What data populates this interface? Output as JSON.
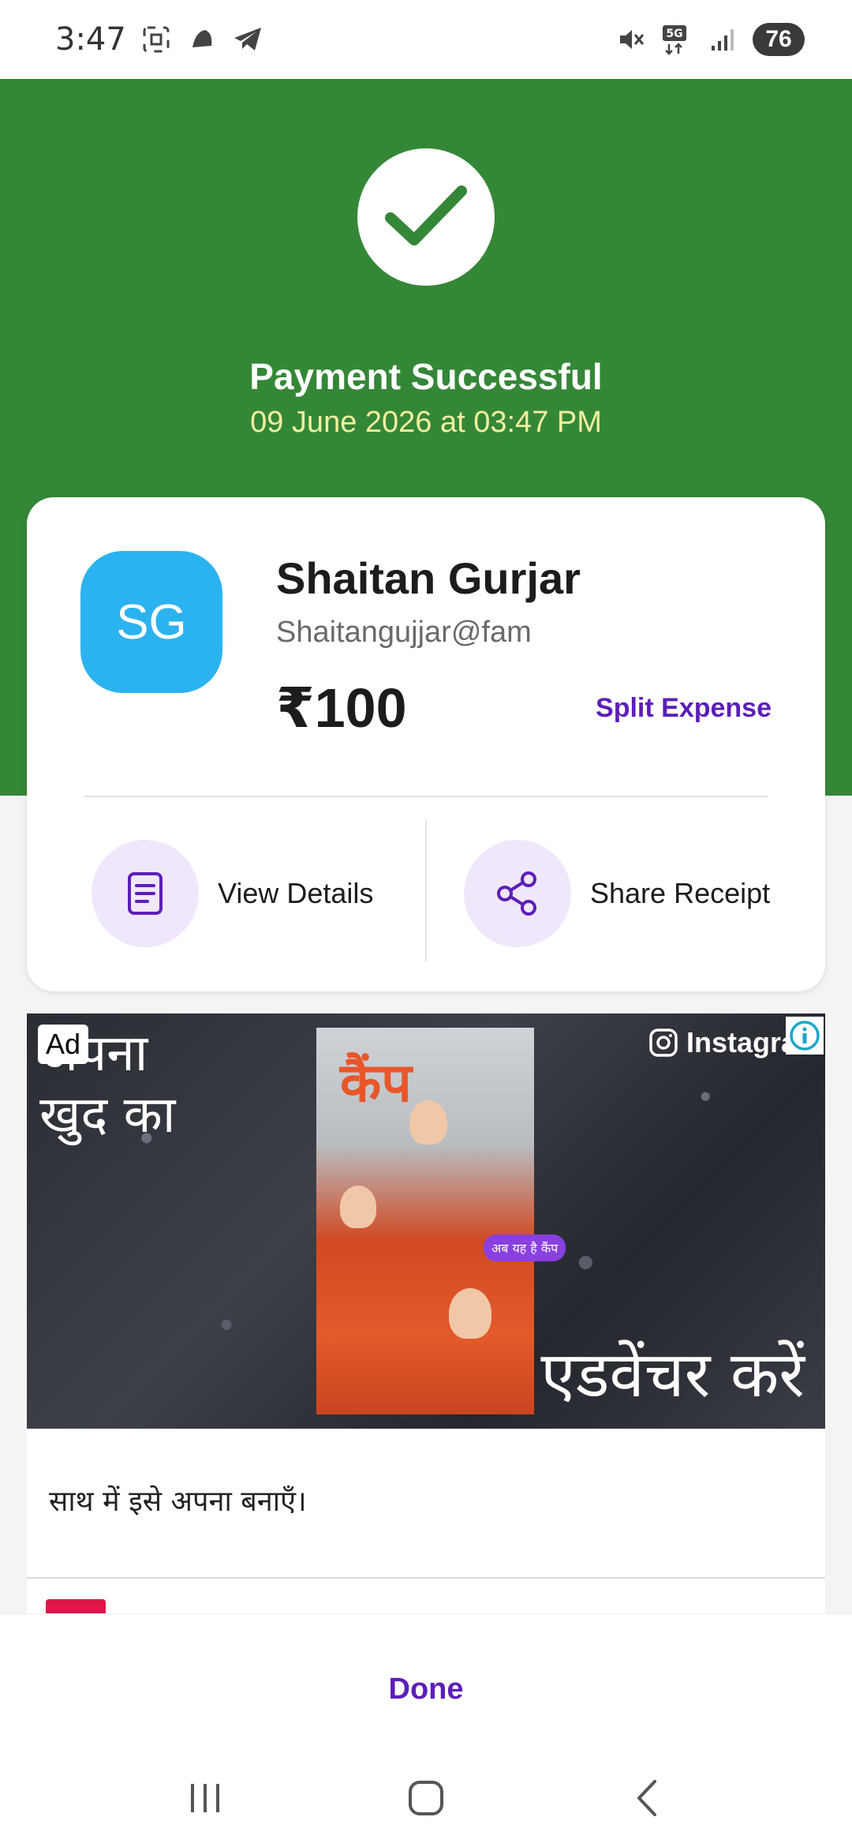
{
  "status_bar": {
    "time": "3:47",
    "battery": "76",
    "network": "5G"
  },
  "header": {
    "title": "Payment Successful",
    "datetime": "09 June 2026 at 03:47 PM",
    "accent_color": "#358738"
  },
  "payee": {
    "initials": "SG",
    "name": "Shaitan Gurjar",
    "upi_id": "Shaitangujjar@fam",
    "amount": "₹100"
  },
  "actions": {
    "split_expense": "Split Expense",
    "view_details": "View Details",
    "share_receipt": "Share Receipt"
  },
  "ad": {
    "badge": "Ad",
    "top_text_line1": "अपना",
    "top_text_line2": "खुद का",
    "brand": "Instagram",
    "poster_title": "कैंप",
    "poster_chip": "अब यह है कैंप",
    "bottom_text": "एडवेंचर करें",
    "caption": "साथ में इसे अपना बनाएँ।"
  },
  "footer": {
    "done_label": "Done"
  },
  "colors": {
    "brand_purple": "#5b1fb8",
    "avatar_blue": "#2bb3f0",
    "action_icon_bg": "#f1e7fb"
  }
}
